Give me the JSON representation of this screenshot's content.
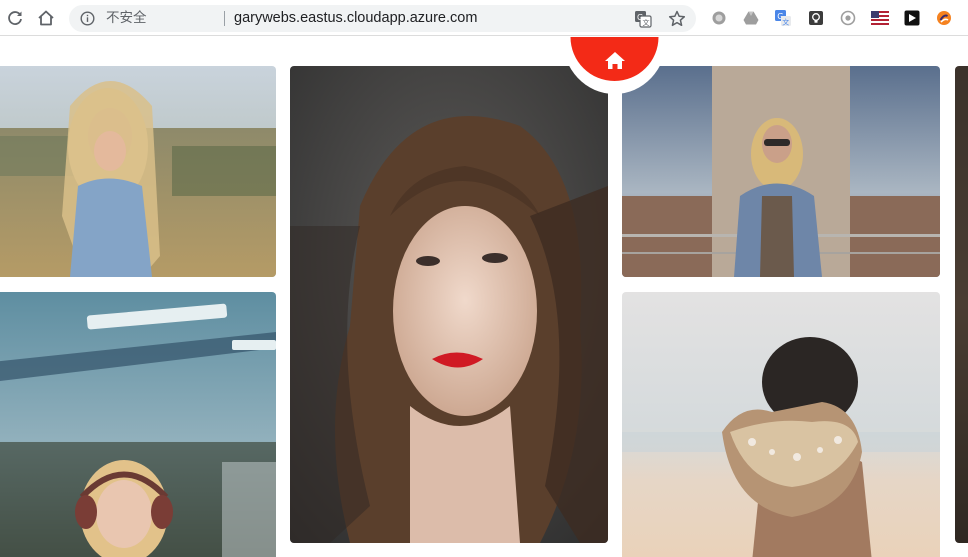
{
  "browser": {
    "insecure_label": "不安全",
    "url": "garywebs.eastus.cloudapp.azure.com",
    "nav": {
      "reload": "reload-icon",
      "home": "home-icon"
    },
    "extensions": [
      "extension-gray-circle-icon",
      "extension-drive-icon",
      "extension-translate-icon",
      "extension-lightbulb-icon",
      "extension-eye-icon",
      "extension-flag-icon",
      "extension-play-icon",
      "extension-orange-icon"
    ]
  },
  "page": {
    "home_button": {
      "icon": "home-icon",
      "color": "#f32a17"
    },
    "photos": [
      {
        "name": "photo-blonde-woman-field"
      },
      {
        "name": "photo-woman-red-lips-portrait"
      },
      {
        "name": "photo-woman-sunglasses-pillar"
      },
      {
        "name": "photo-woman-headphones"
      },
      {
        "name": "photo-hands-holding-sand"
      },
      {
        "name": "photo-partial-right-edge"
      }
    ]
  }
}
